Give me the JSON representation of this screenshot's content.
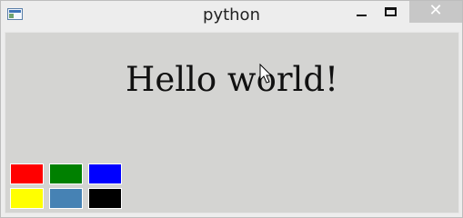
{
  "window": {
    "title": "python",
    "close_label": "✕"
  },
  "main": {
    "text": "Hello world!"
  },
  "palette": {
    "colors": [
      {
        "name": "red",
        "hex": "#ff0000"
      },
      {
        "name": "green",
        "hex": "#008000"
      },
      {
        "name": "blue",
        "hex": "#0000ff"
      },
      {
        "name": "yellow",
        "hex": "#ffff00"
      },
      {
        "name": "steelblue",
        "hex": "#4682b4"
      },
      {
        "name": "black",
        "hex": "#000000"
      }
    ]
  }
}
